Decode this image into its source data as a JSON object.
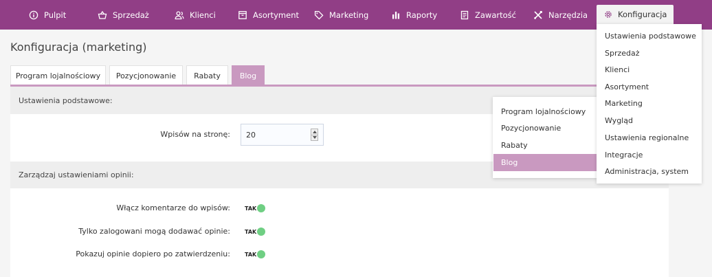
{
  "nav": {
    "items": [
      {
        "label": "Pulpit",
        "icon": "info-icon"
      },
      {
        "label": "Sprzedaż",
        "icon": "basket-icon"
      },
      {
        "label": "Klienci",
        "icon": "users-icon"
      },
      {
        "label": "Asortyment",
        "icon": "box-icon"
      },
      {
        "label": "Marketing",
        "icon": "tag-icon"
      },
      {
        "label": "Raporty",
        "icon": "bar-chart-icon"
      },
      {
        "label": "Zawartość",
        "icon": "document-icon"
      },
      {
        "label": "Narzędzia",
        "icon": "tools-icon"
      },
      {
        "label": "Konfiguracja",
        "icon": "gear-icon",
        "active": true
      }
    ]
  },
  "page": {
    "title": "Konfiguracja (marketing)"
  },
  "tabs": [
    {
      "label": "Program lojalnościowy"
    },
    {
      "label": "Pozycjonowanie"
    },
    {
      "label": "Rabaty"
    },
    {
      "label": "Blog",
      "active": true
    }
  ],
  "sections": {
    "basic": {
      "header": "Ustawienia podstawowe:",
      "per_page_label": "Wpisów na stronę:",
      "per_page_value": "20"
    },
    "opinions": {
      "header": "Zarządzaj ustawieniami opinii:",
      "rows": [
        {
          "label": "Włącz komentarze do wpisów:",
          "value": "TAK"
        },
        {
          "label": "Tylko zalogowani mogą dodawać opinie:",
          "value": "TAK"
        },
        {
          "label": "Pokazuj opinie dopiero po zatwierdzeniu:",
          "value": "TAK"
        }
      ]
    }
  },
  "config_menu": {
    "items": [
      {
        "label": "Ustawienia podstawowe"
      },
      {
        "label": "Sprzedaż"
      },
      {
        "label": "Klienci"
      },
      {
        "label": "Asortyment"
      },
      {
        "label": "Marketing"
      },
      {
        "label": "Wygląd"
      },
      {
        "label": "Ustawienia regionalne"
      },
      {
        "label": "Integracje"
      },
      {
        "label": "Administracja, system"
      }
    ]
  },
  "marketing_submenu": {
    "items": [
      {
        "label": "Program lojalnościowy"
      },
      {
        "label": "Pozycjonowanie"
      },
      {
        "label": "Rabaty"
      },
      {
        "label": "Blog",
        "selected": true
      }
    ]
  },
  "colors": {
    "nav_bg": "#913e86",
    "accent": "#c999c0",
    "toggle_on": "#6fcf83"
  }
}
